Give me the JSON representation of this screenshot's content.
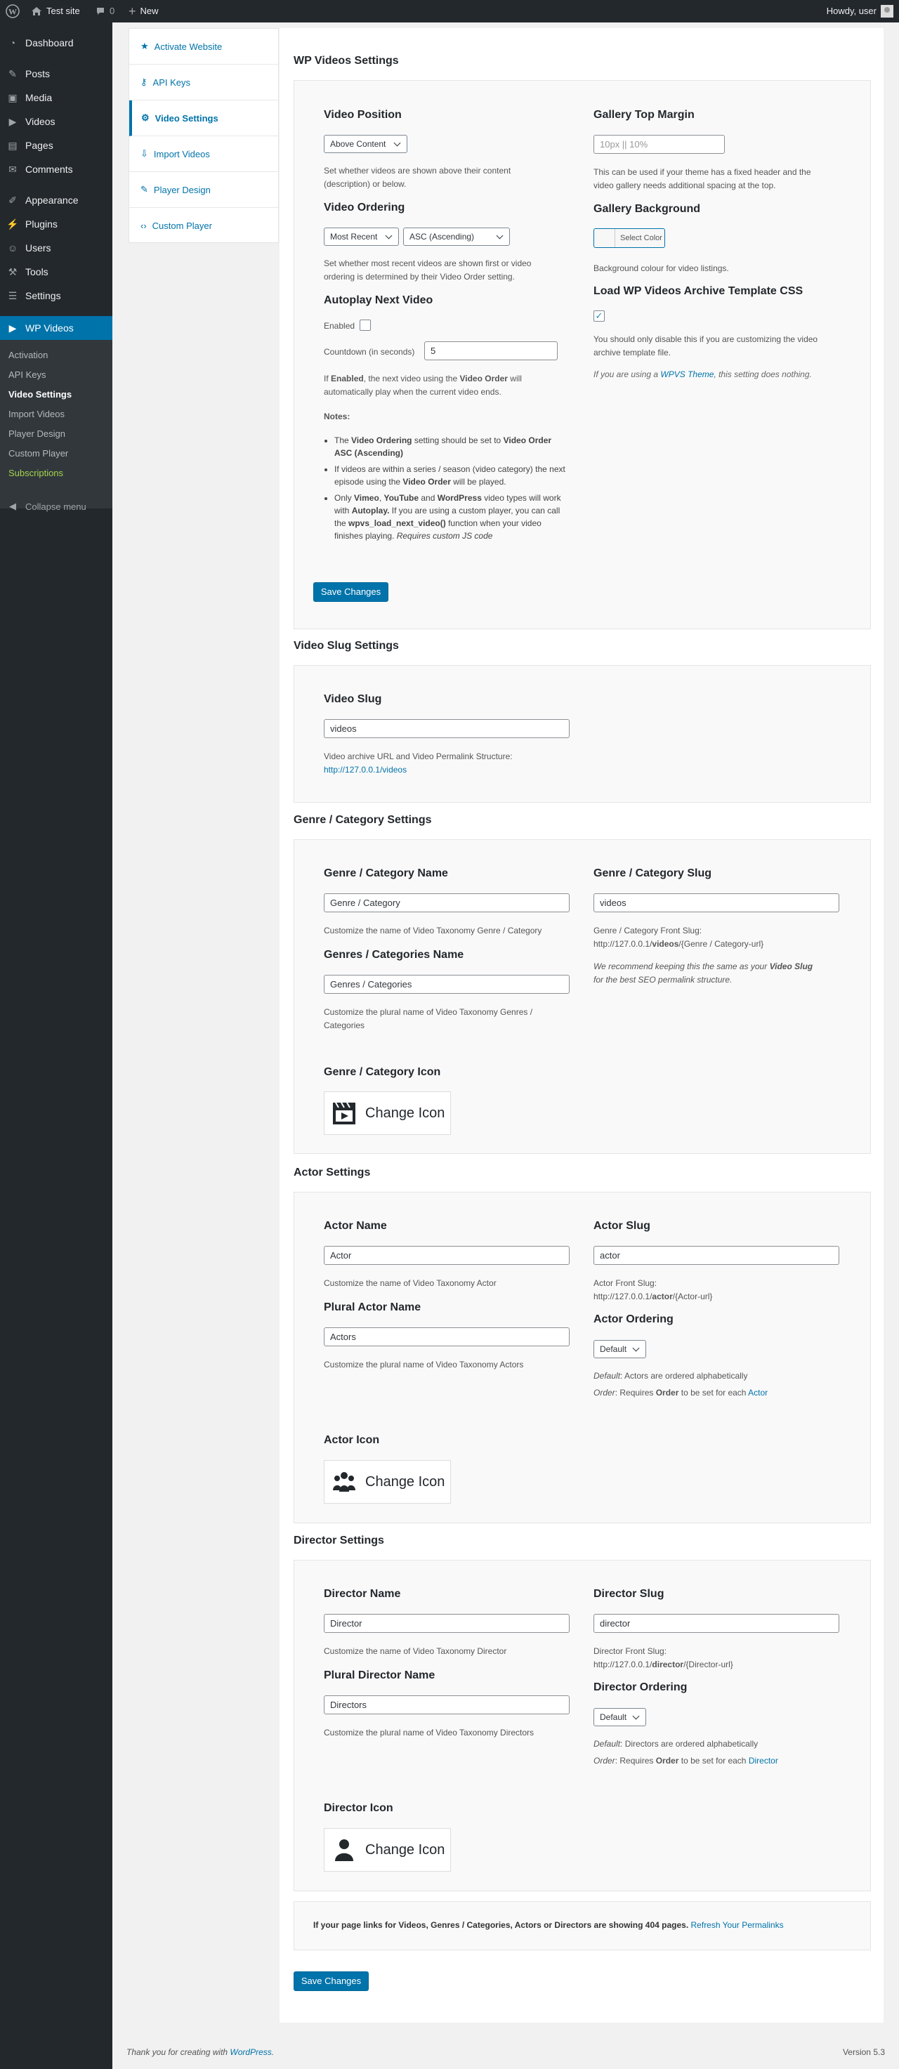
{
  "adminbar": {
    "site": "Test site",
    "comments": "0",
    "new": "New",
    "howdy": "Howdy, user"
  },
  "menu": {
    "dashboard": "Dashboard",
    "posts": "Posts",
    "media": "Media",
    "videos": "Videos",
    "pages": "Pages",
    "comments": "Comments",
    "appearance": "Appearance",
    "plugins": "Plugins",
    "users": "Users",
    "tools": "Tools",
    "settings": "Settings",
    "wpvideos": "WP Videos",
    "sub": [
      "Activation",
      "API Keys",
      "Video Settings",
      "Import Videos",
      "Player Design",
      "Custom Player",
      "Subscriptions"
    ],
    "collapse": "Collapse menu"
  },
  "nav": [
    "Activate Website",
    "API Keys",
    "Video Settings",
    "Import Videos",
    "Player Design",
    "Custom Player"
  ],
  "video": {
    "heading": "WP Videos Settings",
    "pos_label": "Video Position",
    "pos_val": "Above Content",
    "pos_desc1": "Set whether videos are shown above their content",
    "pos_desc2": "(description) or below.",
    "ord_label": "Video Ordering",
    "ord_val1": "Most Recent",
    "ord_val2": "ASC (Ascending)",
    "ord_desc1": "Set whether most recent videos are shown first or video",
    "ord_desc2": "ordering is determined by their Video Order setting.",
    "auto_label": "Autoplay Next Video",
    "enabled": "Enabled",
    "countdown": "Countdown (in seconds)",
    "countdown_val": "5",
    "auto_desc1a": "If ",
    "auto_desc1b": "Enabled",
    "auto_desc1c": ", the next video using the ",
    "auto_desc1d": "Video Order",
    "auto_desc1e": " will",
    "auto_desc2": "automatically play when the current video ends.",
    "notes": "Notes:",
    "margin_label": "Gallery Top Margin",
    "margin_ph": "10px || 10%",
    "margin_desc1": "This can be used if your theme has a fixed header and the",
    "margin_desc2": "video gallery needs additional spacing at the top.",
    "bg_label": "Gallery Background",
    "bg_btn": "Select Color",
    "bg_desc": "Background colour for video listings.",
    "css_label": "Load WP Videos Archive Template CSS",
    "css_desc1": "You should only disable this if you are customizing the video",
    "css_desc2": "archive template file.",
    "theme_a": "If you are using a ",
    "theme_link": "WPVS Theme",
    "theme_b": ", this setting does nothing.",
    "save": "Save Changes"
  },
  "slug": {
    "heading": "Video Slug Settings",
    "label": "Video Slug",
    "value": "videos",
    "desc": "Video archive URL and Video Permalink Structure:",
    "link": "http://127.0.0.1/videos"
  },
  "genre": {
    "heading": "Genre / Category Settings",
    "name_label": "Genre / Category Name",
    "name_val": "Genre / Category",
    "name_desc": "Customize the name of Video Taxonomy Genre / Category",
    "plural_label": "Genres / Categories Name",
    "plural_val": "Genres / Categories",
    "plural_desc1": "Customize the plural name of Video Taxonomy Genres /",
    "plural_desc2": "Categories",
    "slug_label": "Genre / Category Slug",
    "slug_val": "videos",
    "front": "Genre / Category Front Slug:",
    "front_a": "http://127.0.0.1/",
    "front_b": "videos",
    "front_c": "/{Genre / Category-url}",
    "rec_a": "We recommend keeping this the same as your ",
    "rec_b": "Video Slug",
    "rec_c": "for the best SEO permalink structure.",
    "icon_label": "Genre / Category Icon",
    "icon_btn": "Change Icon"
  },
  "actor": {
    "heading": "Actor Settings",
    "name_label": "Actor Name",
    "name_val": "Actor",
    "name_desc": "Customize the name of Video Taxonomy Actor",
    "plural_label": "Plural Actor Name",
    "plural_val": "Actors",
    "plural_desc": "Customize the plural name of Video Taxonomy Actors",
    "slug_label": "Actor Slug",
    "slug_val": "actor",
    "front": "Actor Front Slug:",
    "front_a": "http://127.0.0.1/",
    "front_b": "actor",
    "front_c": "/{Actor-url}",
    "ord_label": "Actor Ordering",
    "ord_val": "Default",
    "def_a": "Default",
    "def_b": ": Actors are ordered alphabetically",
    "order_a": "Order",
    "order_b": ": Requires ",
    "order_c": "Order",
    "order_d": " to be set for each ",
    "order_link": "Actor",
    "icon_label": "Actor Icon",
    "icon_btn": "Change Icon"
  },
  "director": {
    "heading": "Director Settings",
    "name_label": "Director Name",
    "name_val": "Director",
    "name_desc": "Customize the name of Video Taxonomy Director",
    "plural_label": "Plural Director Name",
    "plural_val": "Directors",
    "plural_desc": "Customize the plural name of Video Taxonomy Directors",
    "slug_label": "Director Slug",
    "slug_val": "director",
    "front": "Director Front Slug:",
    "front_a": "http://127.0.0.1/",
    "front_b": "director",
    "front_c": "/{Director-url}",
    "ord_label": "Director Ordering",
    "ord_val": "Default",
    "def_a": "Default",
    "def_b": ": Directors are ordered alphabetically",
    "order_a": "Order",
    "order_b": ": Requires ",
    "order_c": "Order",
    "order_d": " to be set for each ",
    "order_link": "Director",
    "icon_label": "Director Icon",
    "icon_btn": "Change Icon"
  },
  "permalinks": {
    "text": "If your page links for Videos, Genres / Categories, Actors or Directors are showing 404 pages.",
    "link": "Refresh Your Permalinks"
  },
  "save2": "Save Changes",
  "footer": {
    "thanks": "Thank you for creating with ",
    "wp": "WordPress",
    "dot": ".",
    "version": "Version 5.3"
  }
}
